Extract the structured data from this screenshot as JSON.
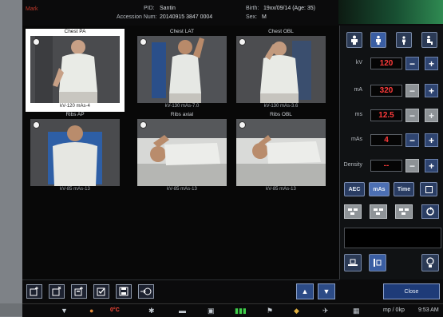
{
  "header": {
    "left_text": "Mark",
    "pid_label": "PID:",
    "pid_value": "Santin",
    "accession_label": "Accession Num:",
    "accession_value": "20140915 3847 0004",
    "birth_label": "Birth:",
    "birth_value": "19xx/09/14 (Age: 35)",
    "sex_label": "Sex:",
    "sex_value": "M"
  },
  "cards": [
    {
      "title": "Chest PA",
      "caption": "kV-120 mAs-4",
      "selected": true
    },
    {
      "title": "Chest LAT",
      "caption": "kV-130 mAs-7.0",
      "selected": false
    },
    {
      "title": "Chest OBL",
      "caption": "kV-130 mAs-3.6",
      "selected": false
    },
    {
      "title": "Ribs AP",
      "caption": "kV-85 mAs-13",
      "selected": false
    },
    {
      "title": "Ribs axial",
      "caption": "kV-85 mAs-13",
      "selected": false
    },
    {
      "title": "Ribs OBL",
      "caption": "kV-85 mAs-13",
      "selected": false
    }
  ],
  "params": {
    "kv": {
      "label": "kV",
      "value": "120"
    },
    "ma": {
      "label": "mA",
      "value": "320"
    },
    "ms": {
      "label": "ms",
      "value": "12.5"
    },
    "mas": {
      "label": "mAs",
      "value": "4"
    },
    "density": {
      "label": "Density",
      "value": "--"
    }
  },
  "modes": {
    "aec": "AEC",
    "mas": "mAs",
    "time": "Time"
  },
  "toolbar": {
    "close_label": "Close"
  },
  "status": {
    "temperature": "0°C",
    "device": "mp / 0kp",
    "time": "9:53 AM"
  },
  "colors": {
    "accent_red": "#ff3b3b",
    "button_blue": "#2c4b86",
    "selected_border": "#ffffff"
  },
  "icons": [
    "patient-large-icon",
    "patient-medium-icon",
    "patient-small-icon",
    "patient-seated-icon",
    "add-exam-icon",
    "delete-exam-icon",
    "append-exam-icon",
    "confirm-exam-icon",
    "save-icon",
    "send-icon",
    "up-arrow-icon",
    "down-arrow-icon",
    "detector-table-icon",
    "detector-wall-icon",
    "lamp-icon",
    "reset-icon"
  ]
}
